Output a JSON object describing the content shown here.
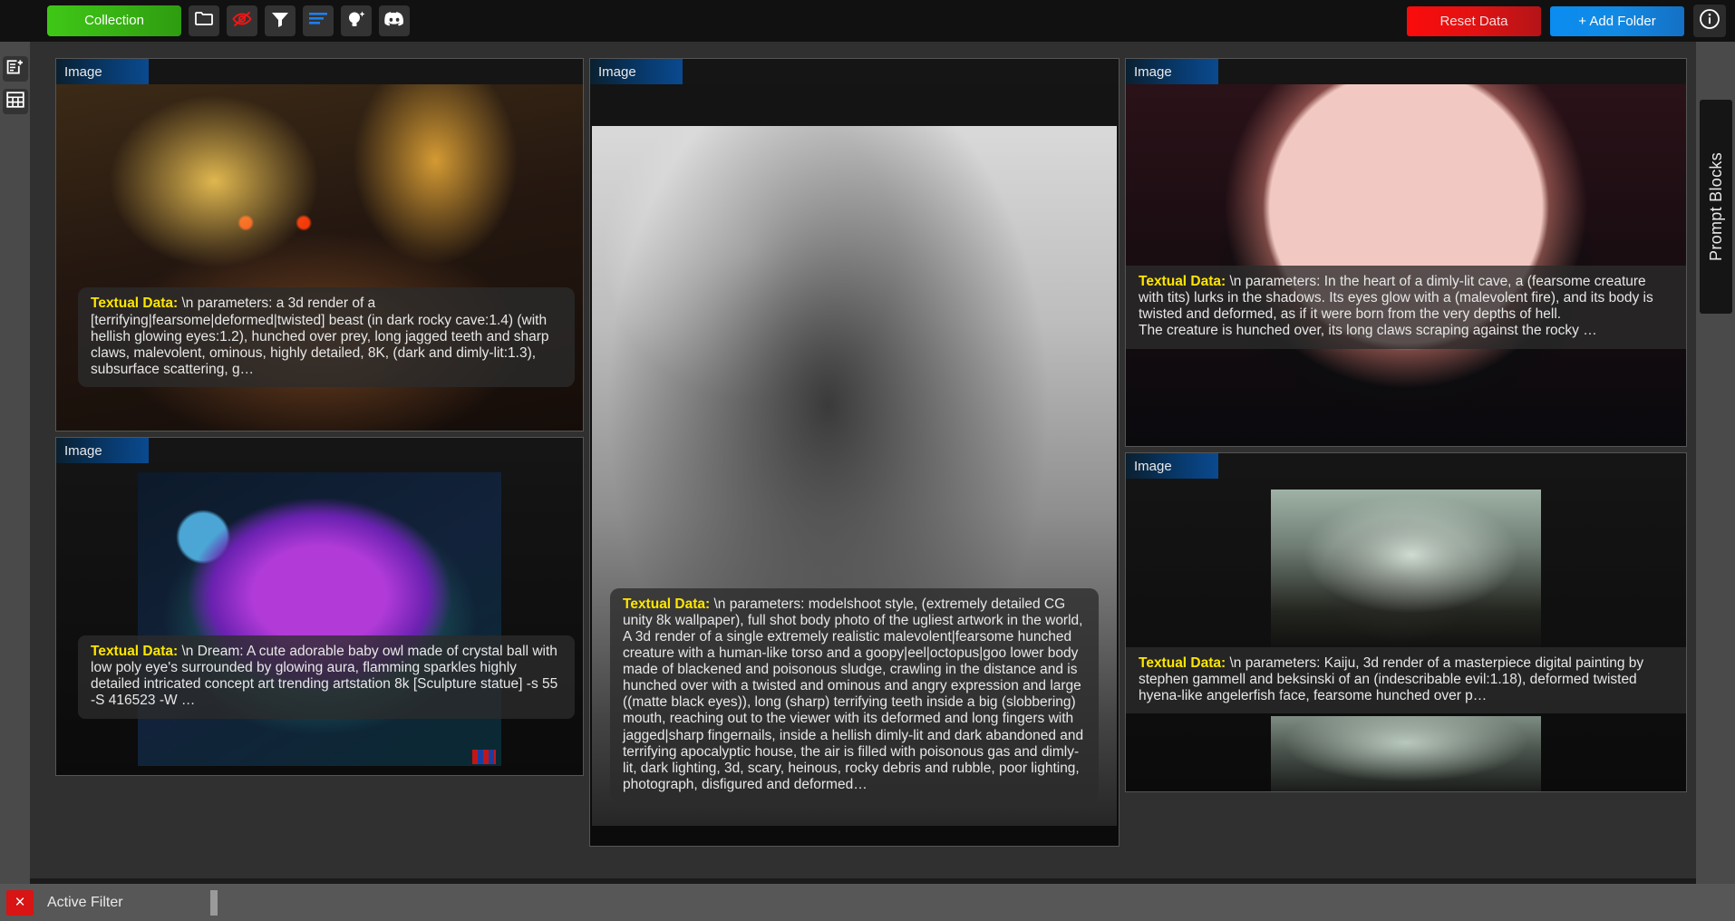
{
  "toolbar": {
    "collection_label": "Collection",
    "icons": [
      {
        "name": "folder-icon",
        "glyph": "folder"
      },
      {
        "name": "eye-off-icon",
        "glyph": "eye-off"
      },
      {
        "name": "filter-icon",
        "glyph": "filter"
      },
      {
        "name": "list-lines-icon",
        "glyph": "lines"
      },
      {
        "name": "magic-bulb-icon",
        "glyph": "bulb"
      },
      {
        "name": "discord-icon",
        "glyph": "discord"
      }
    ],
    "reset_label": "Reset Data",
    "add_folder_label": "+ Add Folder",
    "info_label": "i",
    "accent_green": "#37b113",
    "accent_red": "#e21212",
    "accent_blue": "#128ae4"
  },
  "left_rail": {
    "items": [
      {
        "name": "new-note-icon",
        "label": "new-note"
      },
      {
        "name": "grid-view-icon",
        "label": "grid-view"
      }
    ]
  },
  "right_rail": {
    "prompt_blocks_label": "Prompt Blocks"
  },
  "bottom_bar": {
    "close_glyph": "×",
    "active_filter_label": "Active Filter"
  },
  "cards": [
    {
      "tag": "Image",
      "art": "art-beast",
      "text_label": "Textual Data:",
      "text": " \\n parameters: a 3d render of a [terrifying|fearsome|deformed|twisted] beast (in dark rocky cave:1.4) (with hellish glowing eyes:1.2), hunched over prey, long jagged teeth and sharp claws, malevolent, ominous, highly detailed, 8K, (dark and dimly-lit:1.3), subsurface scattering, g…"
    },
    {
      "tag": "Image",
      "art": "art-owl",
      "text_label": "Textual Data:",
      "text": " \\n Dream: A cute adorable baby owl made of crystal ball with low poly eye's surrounded by glowing aura, flamming sparkles highly detailed intricated concept art trending artstation 8k [Sculpture statue] -s 55 -S 416523 -W …"
    },
    {
      "tag": "Image",
      "art": "art-skel",
      "text_label": "Textual Data:",
      "text": " \\n parameters: modelshoot style, (extremely detailed CG unity 8k wallpaper), full shot body photo of the ugliest artwork in the world, A 3d render of a single extremely realistic malevolent|fearsome hunched creature with a human-like torso and a goopy|eel|octopus|goo lower body made of blackened and poisonous sludge, crawling in the distance and is hunched over with a twisted and ominous and angry expression and large ((matte black eyes)), long (sharp) terrifying teeth inside a big (slobbering) mouth, reaching out to the viewer with its deformed and long fingers with jagged|sharp fingernails, inside a hellish dimly-lit and dark abandoned and terrifying apocalyptic house, the air is filled with poisonous gas and dimly-lit, dark lighting, 3d, scary, heinous, rocky debris and rubble, poor lighting, photograph, disfigured and deformed…"
    },
    {
      "tag": "Image",
      "art": "art-moon",
      "text_label": "Textual Data:",
      "text": " \\n parameters: In the heart of a dimly-lit cave, a (fearsome creature with tits) lurks in the shadows. Its eyes glow with a (malevolent fire), and its body is twisted and deformed, as if it were born from the very depths of hell.\nThe creature is hunched over, its long claws scraping against the rocky …"
    },
    {
      "tag": "Image",
      "art": "art-kaiju",
      "text_label": "Textual Data:",
      "text": " \\n parameters: Kaiju, 3d render of a masterpiece digital painting by stephen gammell and beksinski of an (indescribable evil:1.18), deformed twisted hyena-like angelerfish face, fearsome hunched over p…"
    }
  ]
}
